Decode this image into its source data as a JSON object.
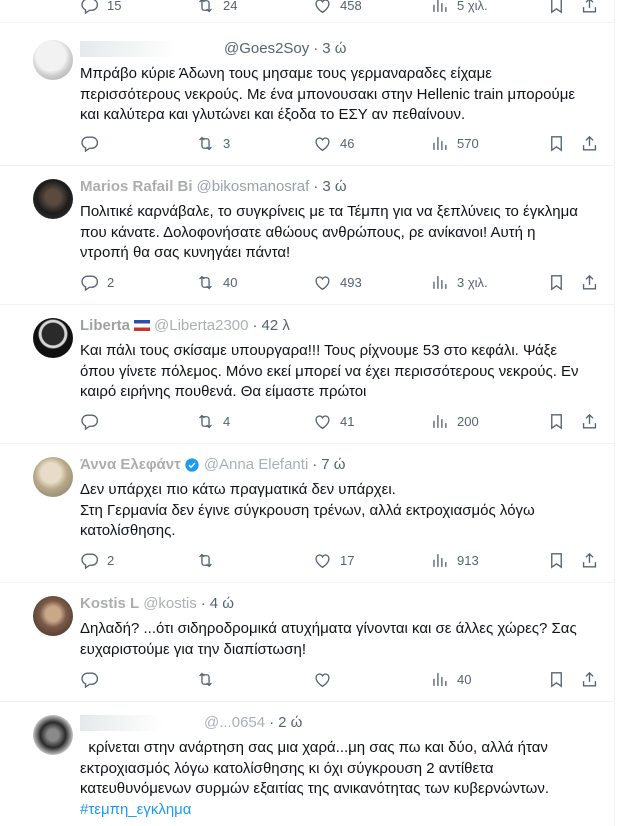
{
  "top_bar": {
    "replies": "15",
    "reposts": "24",
    "likes": "458",
    "views": "5 χιλ."
  },
  "tweets": [
    {
      "name": "",
      "handle": "@Goes2Soy",
      "time": "3 ώ",
      "lines": [
        "Μπράβο κύριε Άδωνη τους     μησαμε τους γερμαναραδες είχαμε",
        "περισσότερους νεκρούς. Με ένα μπονουσακι στην Hellenic train μπορούμε",
        "και καλύτερα και γλυτώνει και έξοδα το ΕΣΥ αν πεθαίνουν."
      ],
      "replies": "",
      "reposts": "3",
      "likes": "46",
      "views": "570",
      "avatar": "blurred-gray"
    },
    {
      "name": "Marios Rafail Bi",
      "handle": "@bikosmanosraf",
      "time": "3 ώ",
      "lines": [
        "Πολιτικέ καρνάβαλε, το συγκρίνεις με τα Τέμπη για να ξεπλύνεις το έγκλημα",
        "που κάνατε. Δολοφονήσατε αθώους ανθρώπους, ρε ανίκανοι! Αυτή η",
        "ντροπή θα σας κυνηγάει πάντα!"
      ],
      "replies": "2",
      "reposts": "40",
      "likes": "493",
      "views": "3 χιλ.",
      "avatar": "dark-photo"
    },
    {
      "name": "Liberta",
      "handle": "@Liberta2300",
      "time": "42 λ",
      "lines": [
        "Και πάλι τους σκίσαμε υπουργαρα!!!  Τους ρίχνουμε 53 στο κεφάλι.  Ψάξε",
        "όπου γίνετε πόλεμος. Μόνο εκεί μπορεί να έχει περισσότερους νεκρούς. Εν",
        "καιρό ειρήνης πουθενά. Θα είμαστε πρώτοι"
      ],
      "replies": "",
      "reposts": "4",
      "likes": "41",
      "views": "200",
      "avatar": "dark-silhouette"
    },
    {
      "name": "Άννα Ελεφάντ",
      "handle": "@Anna Elefanti",
      "time": "7 ώ",
      "lines": [
        "Δεν υπάρχει πιο κάτω πραγματικά δεν υπάρχει.",
        "Στη Γερμανία δεν έγινε σύγκρουση τρένων, αλλά εκτροχιασμός λόγω",
        "κατολίσθησης."
      ],
      "replies": "2",
      "reposts": "",
      "likes": "17",
      "views": "913",
      "avatar": "light-photo"
    },
    {
      "name": "Kostis L",
      "handle": "@kostis",
      "time": "4 ώ",
      "lines": [
        "Δηλαδή? ...ότι σιδηροδρομικά ατυχήματα γίνονται και σε άλλες χώρες? Σας",
        "ευχαριστούμε για την διαπίστωση!"
      ],
      "replies": "",
      "reposts": "",
      "likes": "",
      "views": "40",
      "avatar": "brown-photo"
    },
    {
      "name": "",
      "handle": "@...0654",
      "time": "2 ώ",
      "lines": [
        "  κρίνεται στην ανάρτηση σας μια χαρά...μη σας πω και δύο, αλλά ήταν",
        "εκτροχιασμός λόγω κατολίσθησης κι όχι σύγκρουση 2 αντίθετα",
        "κατευθυνόμενων συρμών εξαιτίας της ανικανότητας των κυβερνώντων."
      ],
      "hashtag": "#τεμπη_εγκλημα",
      "avatar": "dark-sketch"
    }
  ],
  "icons": {
    "reply": "reply-icon",
    "repost": "repost-icon",
    "like": "heart-icon",
    "views": "views-icon",
    "bookmark": "bookmark-icon",
    "share": "share-icon"
  },
  "colors": {
    "text": "#0f1419",
    "secondary": "#536471",
    "link": "#1d9bf0",
    "border": "#eff3f4",
    "verified": "#1d9bf0"
  }
}
